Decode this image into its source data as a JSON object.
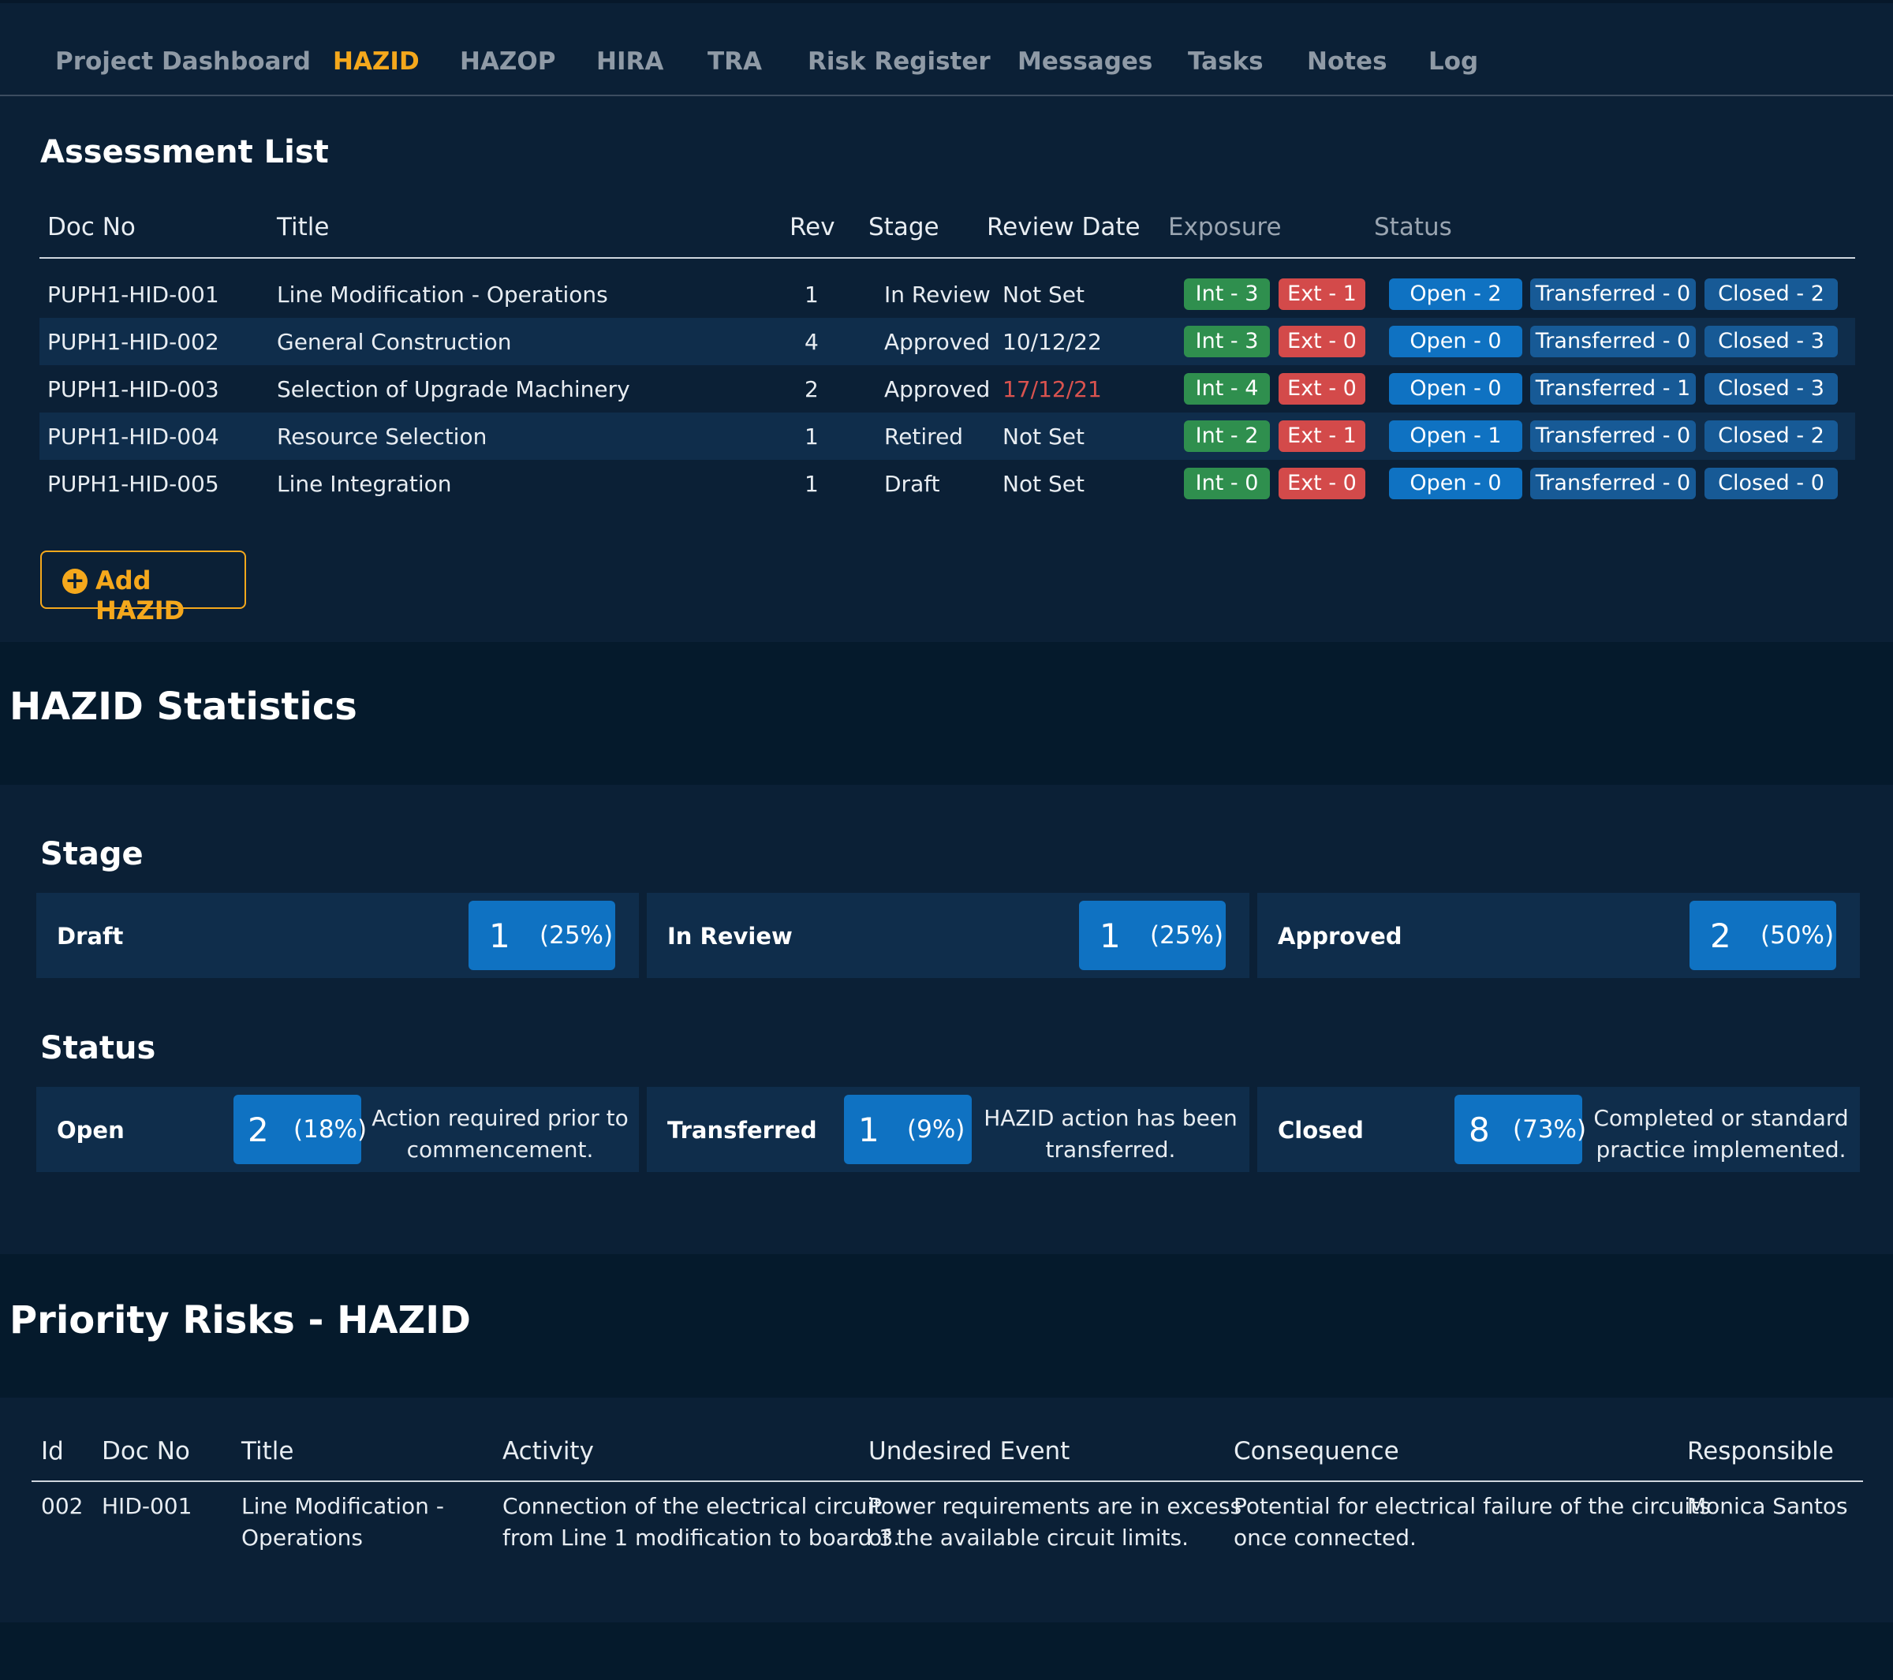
{
  "tabs": [
    {
      "label": "Project Dashboard",
      "active": false
    },
    {
      "label": "HAZID",
      "active": true
    },
    {
      "label": "HAZOP",
      "active": false
    },
    {
      "label": "HIRA",
      "active": false
    },
    {
      "label": "TRA",
      "active": false
    },
    {
      "label": "Risk Register",
      "active": false
    },
    {
      "label": "Messages",
      "active": false
    },
    {
      "label": "Tasks",
      "active": false
    },
    {
      "label": "Notes",
      "active": false
    },
    {
      "label": "Log",
      "active": false
    }
  ],
  "assessment": {
    "heading": "Assessment List",
    "columns": {
      "doc_no": "Doc No",
      "title": "Title",
      "rev": "Rev",
      "stage": "Stage",
      "review_date": "Review Date",
      "exposure": "Exposure",
      "status": "Status"
    },
    "rows": [
      {
        "doc_no": "PUPH1-HID-001",
        "title": "Line Modification - Operations",
        "rev": "1",
        "stage": "In Review",
        "review_date": "Not Set",
        "int": "Int - 3",
        "ext": "Ext - 1",
        "open": "Open - 2",
        "transferred": "Transferred - 0",
        "closed": "Closed - 2"
      },
      {
        "doc_no": "PUPH1-HID-002",
        "title": "General Construction",
        "rev": "4",
        "stage": "Approved",
        "review_date": "10/12/22",
        "int": "Int - 3",
        "ext": "Ext - 0",
        "open": "Open - 0",
        "transferred": "Transferred - 0",
        "closed": "Closed - 3"
      },
      {
        "doc_no": "PUPH1-HID-003",
        "title": "Selection of Upgrade Machinery",
        "rev": "2",
        "stage": "Approved",
        "review_date": "17/12/21",
        "int": "Int - 4",
        "ext": "Ext - 0",
        "open": "Open - 0",
        "transferred": "Transferred - 1",
        "closed": "Closed - 3"
      },
      {
        "doc_no": "PUPH1-HID-004",
        "title": "Resource Selection",
        "rev": "1",
        "stage": "Retired",
        "review_date": "Not Set",
        "int": "Int - 2",
        "ext": "Ext - 1",
        "open": "Open - 1",
        "transferred": "Transferred - 0",
        "closed": "Closed - 2"
      },
      {
        "doc_no": "PUPH1-HID-005",
        "title": "Line Integration",
        "rev": "1",
        "stage": "Draft",
        "review_date": "Not Set",
        "int": "Int - 0",
        "ext": "Ext - 0",
        "open": "Open - 0",
        "transferred": "Transferred - 0",
        "closed": "Closed - 0"
      }
    ],
    "overdue_color": "#d9534f",
    "add_button": {
      "icon": "plus-circle-icon",
      "label": "Add HAZID"
    }
  },
  "statistics": {
    "heading": "HAZID Statistics",
    "stage": {
      "heading": "Stage",
      "cards": [
        {
          "name": "Draft",
          "count": "1",
          "pct": "(25%)"
        },
        {
          "name": "In Review",
          "count": "1",
          "pct": "(25%)"
        },
        {
          "name": "Approved",
          "count": "2",
          "pct": "(50%)"
        }
      ]
    },
    "status": {
      "heading": "Status",
      "cards": [
        {
          "name": "Open",
          "count": "2",
          "pct": "(18%)",
          "desc_1": "Action required prior to",
          "desc_2": "commencement."
        },
        {
          "name": "Transferred",
          "count": "1",
          "pct": "(9%)",
          "desc_1": "HAZID action has been",
          "desc_2": "transferred."
        },
        {
          "name": "Closed",
          "count": "8",
          "pct": "(73%)",
          "desc_1": "Completed or standard",
          "desc_2": "practice implemented."
        }
      ]
    }
  },
  "priority": {
    "heading": "Priority Risks - HAZID",
    "columns": {
      "id": "Id",
      "doc_no": "Doc No",
      "title": "Title",
      "activity": "Activity",
      "event": "Undesired Event",
      "consequence": "Consequence",
      "responsible": "Responsible"
    },
    "rows": [
      {
        "id": "002",
        "doc_no": "HID-001",
        "title_1": "Line Modification -",
        "title_2": "Operations",
        "activity_1": "Connection of the electrical circuit",
        "activity_2": "from Line 1 modification to board 3.",
        "event_1": "Power requirements are in excess",
        "event_2": "of the available circuit limits.",
        "consequence_1": "Potential for electrical failure of the circuits",
        "consequence_2": "once connected.",
        "responsible": "Monica Santos"
      }
    ]
  },
  "colors": {
    "background": "#0b2036",
    "band": "#051a2c",
    "accent": "#f5a81c",
    "int_badge": "#2f8f4e",
    "ext_badge": "#d34a4a",
    "open_badge": "#0f72c2",
    "status_badge": "#175a96"
  }
}
